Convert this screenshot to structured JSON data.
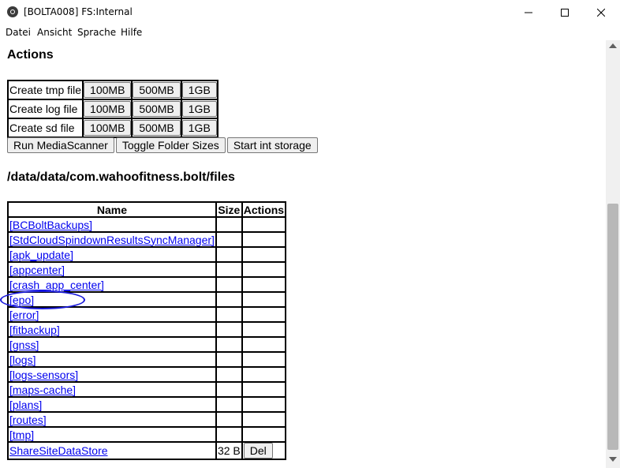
{
  "window": {
    "title": "[BOLTA008] FS:Internal",
    "controls": [
      "minimize-icon",
      "maximize-icon",
      "close-icon"
    ]
  },
  "menu": {
    "items": [
      {
        "label": "Datei"
      },
      {
        "label": "Ansicht"
      },
      {
        "label": "Sprache"
      },
      {
        "label": "Hilfe"
      }
    ]
  },
  "actions": {
    "heading": "Actions",
    "rows": [
      {
        "label": "Create tmp file",
        "buttons": [
          "100MB",
          "500MB",
          "1GB"
        ]
      },
      {
        "label": "Create log file",
        "buttons": [
          "100MB",
          "500MB",
          "1GB"
        ]
      },
      {
        "label": "Create sd file",
        "buttons": [
          "100MB",
          "500MB",
          "1GB"
        ]
      }
    ],
    "extra_buttons": [
      "Run MediaScanner",
      "Toggle Folder Sizes",
      "Start int storage"
    ]
  },
  "files": {
    "path": "/data/data/com.wahoofitness.bolt/files",
    "columns": [
      "Name",
      "Size",
      "Actions"
    ],
    "rows": [
      {
        "name": "[BCBoltBackups]",
        "size": "",
        "action": ""
      },
      {
        "name": "[StdCloudSpindownResultsSyncManager]",
        "size": "",
        "action": ""
      },
      {
        "name": "[apk_update]",
        "size": "",
        "action": ""
      },
      {
        "name": "[appcenter]",
        "size": "",
        "action": ""
      },
      {
        "name": "[crash_app_center]",
        "size": "",
        "action": ""
      },
      {
        "name": "[epo]",
        "size": "",
        "action": ""
      },
      {
        "name": "[error]",
        "size": "",
        "action": ""
      },
      {
        "name": "[fitbackup]",
        "size": "",
        "action": ""
      },
      {
        "name": "[gnss]",
        "size": "",
        "action": ""
      },
      {
        "name": "[logs]",
        "size": "",
        "action": ""
      },
      {
        "name": "[logs-sensors]",
        "size": "",
        "action": ""
      },
      {
        "name": "[maps-cache]",
        "size": "",
        "action": ""
      },
      {
        "name": "[plans]",
        "size": "",
        "action": ""
      },
      {
        "name": "[routes]",
        "size": "",
        "action": ""
      },
      {
        "name": "[tmp]",
        "size": "",
        "action": ""
      },
      {
        "name": "ShareSiteDataStore",
        "size": "32 B",
        "action": "Del"
      }
    ]
  },
  "colors": {
    "link": "#0000ee",
    "annotation": "#1a1adb",
    "button_bg": "#efefef"
  }
}
